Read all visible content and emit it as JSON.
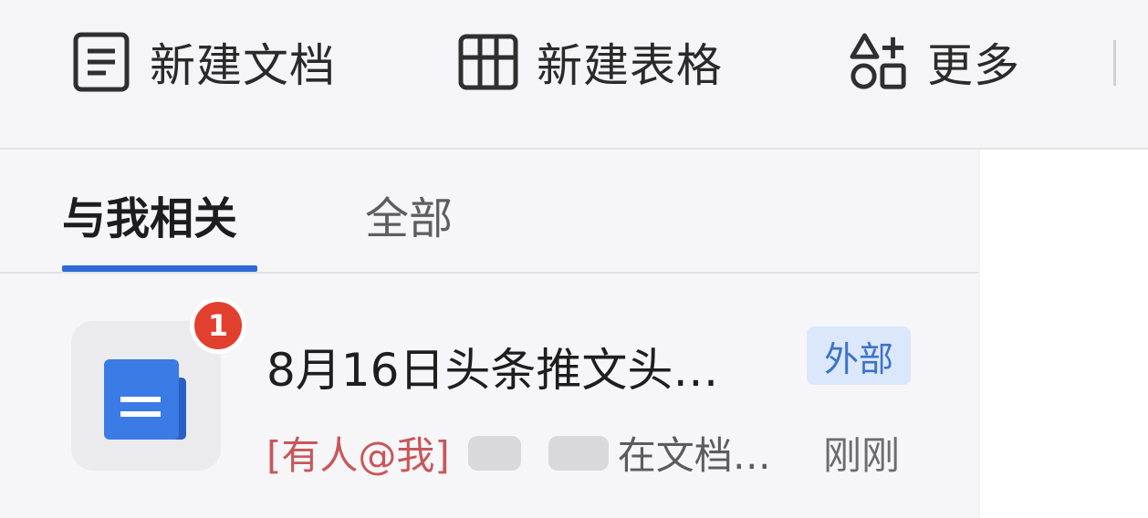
{
  "toolbar": {
    "new_doc": {
      "label": "新建文档",
      "icon": "document-icon"
    },
    "new_sheet": {
      "label": "新建表格",
      "icon": "table-grid-icon"
    },
    "more": {
      "label": "更多",
      "icon": "shapes-plus-icon"
    }
  },
  "tabs": [
    {
      "label": "与我相关",
      "active": true
    },
    {
      "label": "全部",
      "active": false
    }
  ],
  "items": [
    {
      "icon": "blue-doc-file-icon",
      "badge": "1",
      "title": "8月16日头条推文头…",
      "tag": "外部",
      "mention": "[有人@我]",
      "subtitle_rest": "在文档…",
      "time": "刚刚"
    }
  ],
  "colors": {
    "accent": "#2d6ad8",
    "badge": "#e2402f",
    "mention": "#c8575a",
    "tag_bg": "#dbe8fb",
    "tag_text": "#3e72c9",
    "doc_icon": "#3a7be6"
  }
}
